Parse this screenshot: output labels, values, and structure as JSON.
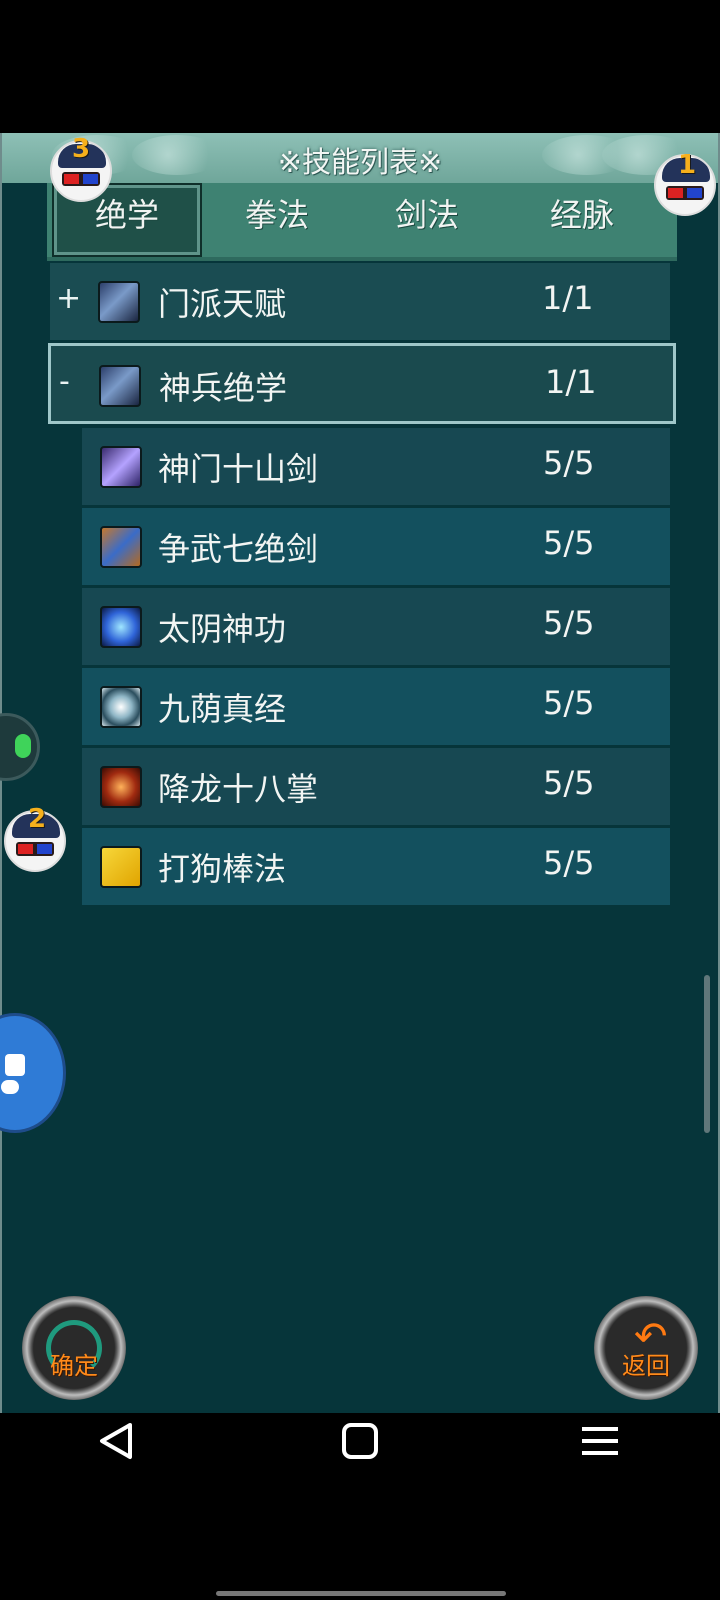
{
  "header": {
    "title": "※技能列表※"
  },
  "tabs": [
    {
      "label": "绝学",
      "active": true
    },
    {
      "label": "拳法",
      "active": false
    },
    {
      "label": "剑法",
      "active": false
    },
    {
      "label": "经脉",
      "active": false
    }
  ],
  "groups": [
    {
      "toggle": "+",
      "name": "门派天赋",
      "count": "1/1",
      "icon": "book-icon"
    },
    {
      "toggle": "-",
      "name": "神兵绝学",
      "count": "1/1",
      "icon": "book-icon"
    }
  ],
  "skills": [
    {
      "name": "神门十山剑",
      "count": "5/5",
      "icon": "purple-sword-icon"
    },
    {
      "name": "争武七绝剑",
      "count": "5/5",
      "icon": "orange-sword-icon"
    },
    {
      "name": "太阴神功",
      "count": "5/5",
      "icon": "blue-aura-icon"
    },
    {
      "name": "九荫真经",
      "count": "5/5",
      "icon": "swirl-icon"
    },
    {
      "name": "降龙十八掌",
      "count": "5/5",
      "icon": "dragon-palm-icon"
    },
    {
      "name": "打狗棒法",
      "count": "5/5",
      "icon": "yellow-hand-icon"
    }
  ],
  "avatars": [
    {
      "number": "3"
    },
    {
      "number": "1"
    },
    {
      "number": "2"
    }
  ],
  "buttons": {
    "confirm": "确定",
    "back": "返回"
  },
  "colors": {
    "accent_orange": "#ff8a1a",
    "panel": "#06353a",
    "tab_bar": "#3e8272"
  }
}
